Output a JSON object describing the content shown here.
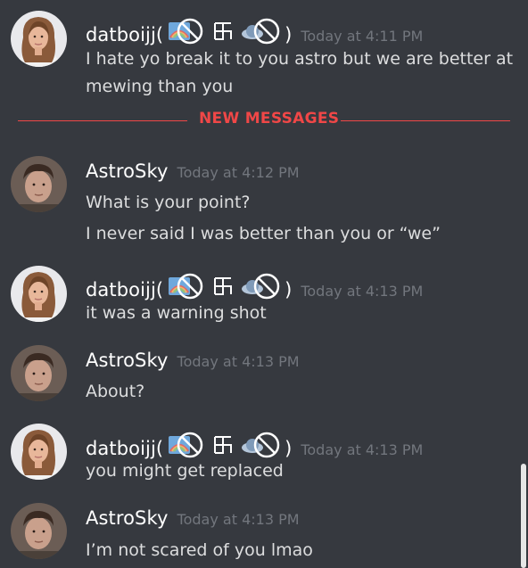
{
  "divider": {
    "label": "NEW MESSAGES"
  },
  "messages": [
    {
      "username": "datboijj",
      "badges": [
        "rainbow-no-icon",
        "swastika-icon",
        "planet-no-icon"
      ],
      "timestamp": "Today at 4:11 PM",
      "lines": [
        "I hate yo break it to you astro but we are better at",
        "mewing than you"
      ]
    },
    {
      "username": "AstroSky",
      "badges": [],
      "timestamp": "Today at 4:12 PM",
      "lines": [
        "What is your point?",
        "I never said I was better than you or “we”"
      ]
    },
    {
      "username": "datboijj",
      "badges": [
        "rainbow-no-icon",
        "swastika-icon",
        "planet-no-icon"
      ],
      "timestamp": "Today at 4:13 PM",
      "lines": [
        "it was a warning shot"
      ]
    },
    {
      "username": "AstroSky",
      "badges": [],
      "timestamp": "Today at 4:13 PM",
      "lines": [
        "About?"
      ]
    },
    {
      "username": "datboijj",
      "badges": [
        "rainbow-no-icon",
        "swastika-icon",
        "planet-no-icon"
      ],
      "timestamp": "Today at 4:13 PM",
      "lines": [
        "you might get replaced"
      ]
    },
    {
      "username": "AstroSky",
      "badges": [],
      "timestamp": "Today at 4:13 PM",
      "lines": [
        "I’m not scared of you lmao"
      ]
    }
  ],
  "paren_open": "(",
  "paren_close": ")",
  "colors": {
    "background": "#36393f",
    "username": "#ffffff",
    "timestamp": "#72767d",
    "message_text": "#dcddde",
    "new_messages": "#f04747"
  }
}
